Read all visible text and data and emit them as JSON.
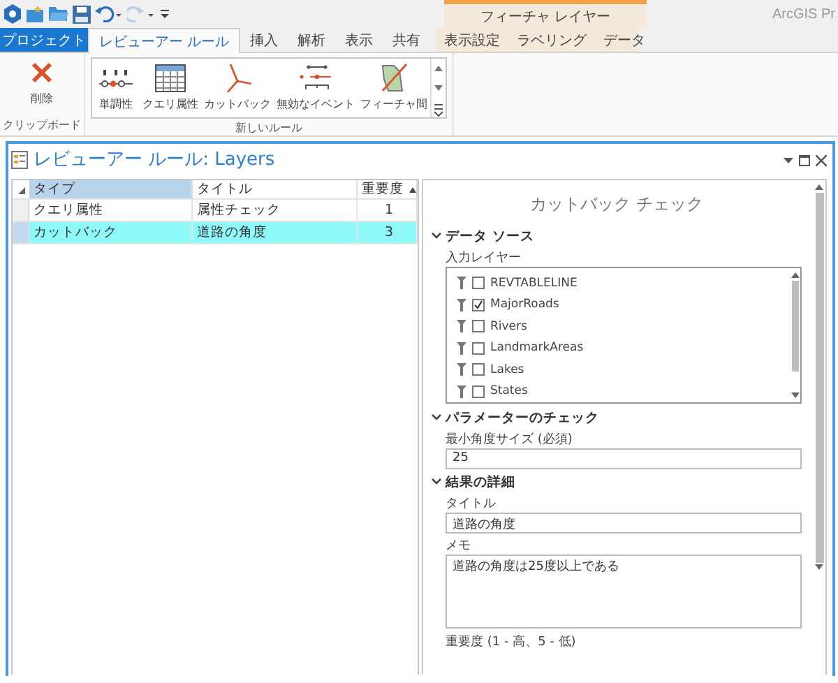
{
  "app": {
    "name": "ArcGIS Pr"
  },
  "tabs": [
    {
      "label": "プロジェクト",
      "kind": "file",
      "selected": false
    },
    {
      "label": "レビューアー ルール",
      "kind": "tab",
      "selected": true
    },
    {
      "label": "挿入",
      "kind": "tab",
      "selected": false
    },
    {
      "label": "解析",
      "kind": "tab",
      "selected": false
    },
    {
      "label": "表示",
      "kind": "tab",
      "selected": false
    },
    {
      "label": "共有",
      "kind": "tab",
      "selected": false
    }
  ],
  "contextual_group": {
    "title": "フィーチャ レイヤー",
    "tabs": [
      {
        "label": "表示設定",
        "selected": false
      },
      {
        "label": "ラベリング",
        "selected": false
      },
      {
        "label": "データ",
        "selected": false
      }
    ]
  },
  "ribbon": {
    "groups": [
      {
        "title": "クリップボード",
        "kind": "plain",
        "buttons": [
          {
            "label": "削除",
            "kind": "delete"
          }
        ]
      },
      {
        "title": "新しいルール",
        "kind": "gallery",
        "buttons": [
          {
            "label": "単調性",
            "kind": "monotonicity"
          },
          {
            "label": "クエリ属性",
            "kind": "table"
          },
          {
            "label": "カットバック",
            "kind": "cutback"
          },
          {
            "label": "無効なイベント",
            "kind": "event"
          },
          {
            "label": "フィーチャ間",
            "kind": "feature"
          }
        ]
      }
    ]
  },
  "pane": {
    "title": "レビューアー ルール: Layers",
    "table": {
      "columns": [
        {
          "label": "タイプ",
          "selected": true,
          "sorted": false
        },
        {
          "label": "タイトル",
          "selected": false,
          "sorted": false
        },
        {
          "label": "重要度",
          "selected": false,
          "sorted": true
        }
      ],
      "rows": [
        {
          "cells": [
            "クエリ属性",
            "属性チェック",
            "1"
          ],
          "selected": false
        },
        {
          "cells": [
            "カットバック",
            "道路の角度",
            "3"
          ],
          "selected": true
        }
      ]
    },
    "details": {
      "title": "カットバック チェック",
      "sections": [
        {
          "title": "データ ソース",
          "expanded": true,
          "fields": [
            {
              "kind": "layers",
              "label": "入力レイヤー",
              "items": [
                {
                  "label": "REVTABLELINE",
                  "checked": false
                },
                {
                  "label": "MajorRoads",
                  "checked": true
                },
                {
                  "label": "Rivers",
                  "checked": false
                },
                {
                  "label": "LandmarkAreas",
                  "checked": false
                },
                {
                  "label": "Lakes",
                  "checked": false
                },
                {
                  "label": "States",
                  "checked": false
                }
              ]
            }
          ]
        },
        {
          "title": "パラメーターのチェック",
          "expanded": true,
          "fields": [
            {
              "kind": "text",
              "label": "最小角度サイズ (必須)",
              "value": "25"
            }
          ]
        },
        {
          "title": "結果の詳細",
          "expanded": true,
          "fields": [
            {
              "kind": "text",
              "label": "タイトル",
              "value": "道路の角度"
            },
            {
              "kind": "textarea",
              "label": "メモ",
              "value": "道路の角度は25度以上である"
            },
            {
              "kind": "label",
              "label": "重要度 (1 - 高、5 - 低)"
            }
          ]
        }
      ]
    }
  }
}
